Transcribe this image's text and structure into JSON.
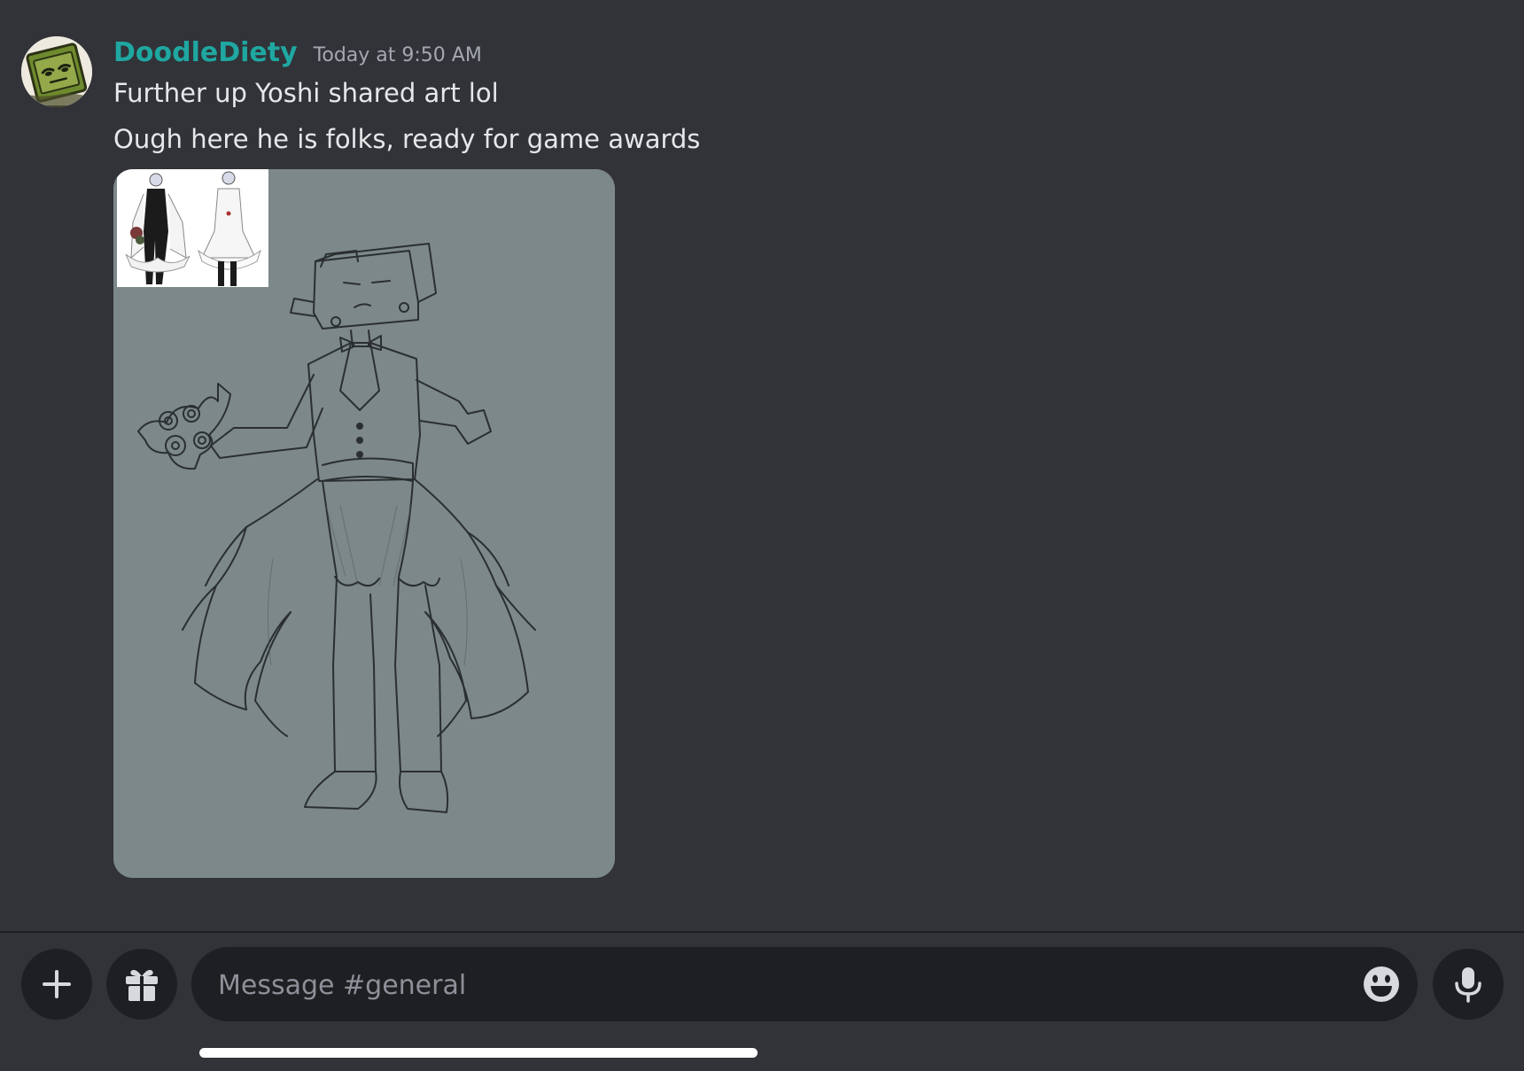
{
  "message": {
    "author": "DoodleDiety",
    "timestamp": "Today at 9:50 AM",
    "lines": [
      "Further up Yoshi shared art lol",
      "Ough here he is folks, ready for game awards"
    ],
    "attachment": {
      "kind": "sketch-image"
    }
  },
  "composer": {
    "placeholder": "Message #general",
    "value": ""
  },
  "icons": {
    "attach": "plus-icon",
    "gift": "gift-icon",
    "emoji": "emoji-icon",
    "voice": "microphone-icon"
  },
  "colors": {
    "background": "#313338",
    "username": "#1fa7a1",
    "input_bg": "#1e1f22"
  }
}
